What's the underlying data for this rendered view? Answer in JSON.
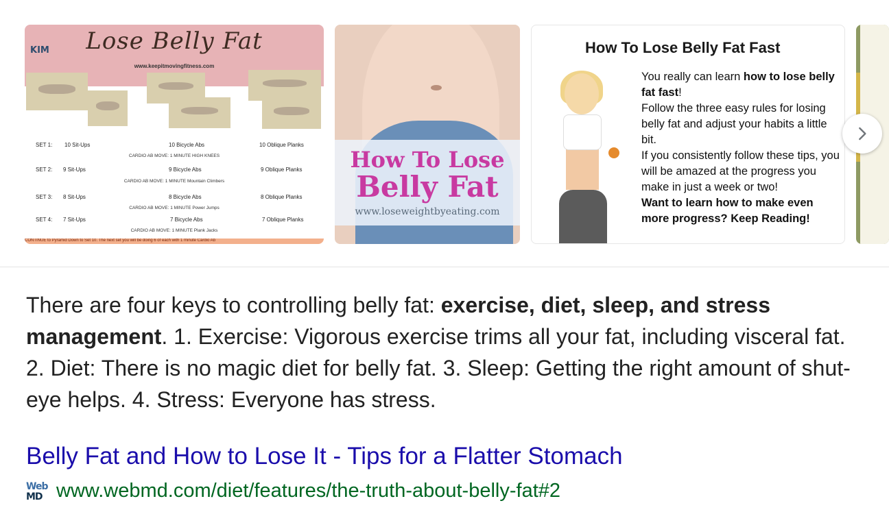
{
  "carousel": {
    "image1": {
      "title": "Lose Belly Fat",
      "logo": "KIM",
      "url": "www.keepitmovingfitness.com",
      "rows": [
        {
          "set": "SET 1:",
          "a": "10 Sit-Ups",
          "b": "10 Bicycle Abs",
          "c": "10 Oblique Planks",
          "cardio": "CARDIO AB MOVE: 1 MINUTE  HIGH KNEES"
        },
        {
          "set": "SET 2:",
          "a": "9 Sit-Ups",
          "b": "9 Bicycle Abs",
          "c": "9 Oblique Planks",
          "cardio": "CARDIO AB MOVE: 1 MINUTE  Mountain Climbers"
        },
        {
          "set": "SET 3:",
          "a": "8 Sit-Ups",
          "b": "8 Bicycle Abs",
          "c": "8 Oblique Planks",
          "cardio": "CARDIO AB MOVE: 1 MINUTE  Power Jumps"
        },
        {
          "set": "SET 4:",
          "a": "7 Sit-Ups",
          "b": "7 Bicycle Abs",
          "c": "7 Oblique Planks",
          "cardio": "CARDIO AB MOVE: 1 MINUTE  Plank Jacks"
        }
      ],
      "footer": "CONTINUE to Pyramid Down to Set 10. The next set you will be doing 6 of each with 1 minute Cardio Ab"
    },
    "image2": {
      "line1": "How To Lose",
      "line2": "Belly Fat",
      "line3": "www.loseweightbyeating.com"
    },
    "image3": {
      "heading": "How To Lose Belly Fat Fast",
      "p1_pre": "You really can learn ",
      "p1_bold": "how to lose belly fat fast",
      "p1_post": "!",
      "p2": "Follow the three easy rules for losing belly fat and adjust your habits a little bit.",
      "p3": "If you consistently follow these tips, you will be amazed at the progress you make in just a week or two!",
      "p4": "Want to learn how to make even more progress?  Keep Reading!"
    },
    "next_icon": "chevron-right-icon"
  },
  "snippet": {
    "pre": "There are four keys to controlling belly fat: ",
    "bold": "exercise, diet, sleep, and stress management",
    "post": ". 1. Exercise: Vigorous exercise trims all your fat, including visceral fat. 2. Diet: There is no magic diet for belly fat. 3. Sleep: Getting the right amount of shut-eye helps. 4. Stress: Everyone has stress."
  },
  "result": {
    "title": "Belly Fat and How to Lose It - Tips for a Flatter Stomach",
    "favicon_top": "Web",
    "favicon_bottom": "MD",
    "url": "www.webmd.com/diet/features/the-truth-about-belly-fat#2"
  },
  "colors": {
    "link": "#1a0dab",
    "url": "#006621",
    "text": "#222222"
  }
}
